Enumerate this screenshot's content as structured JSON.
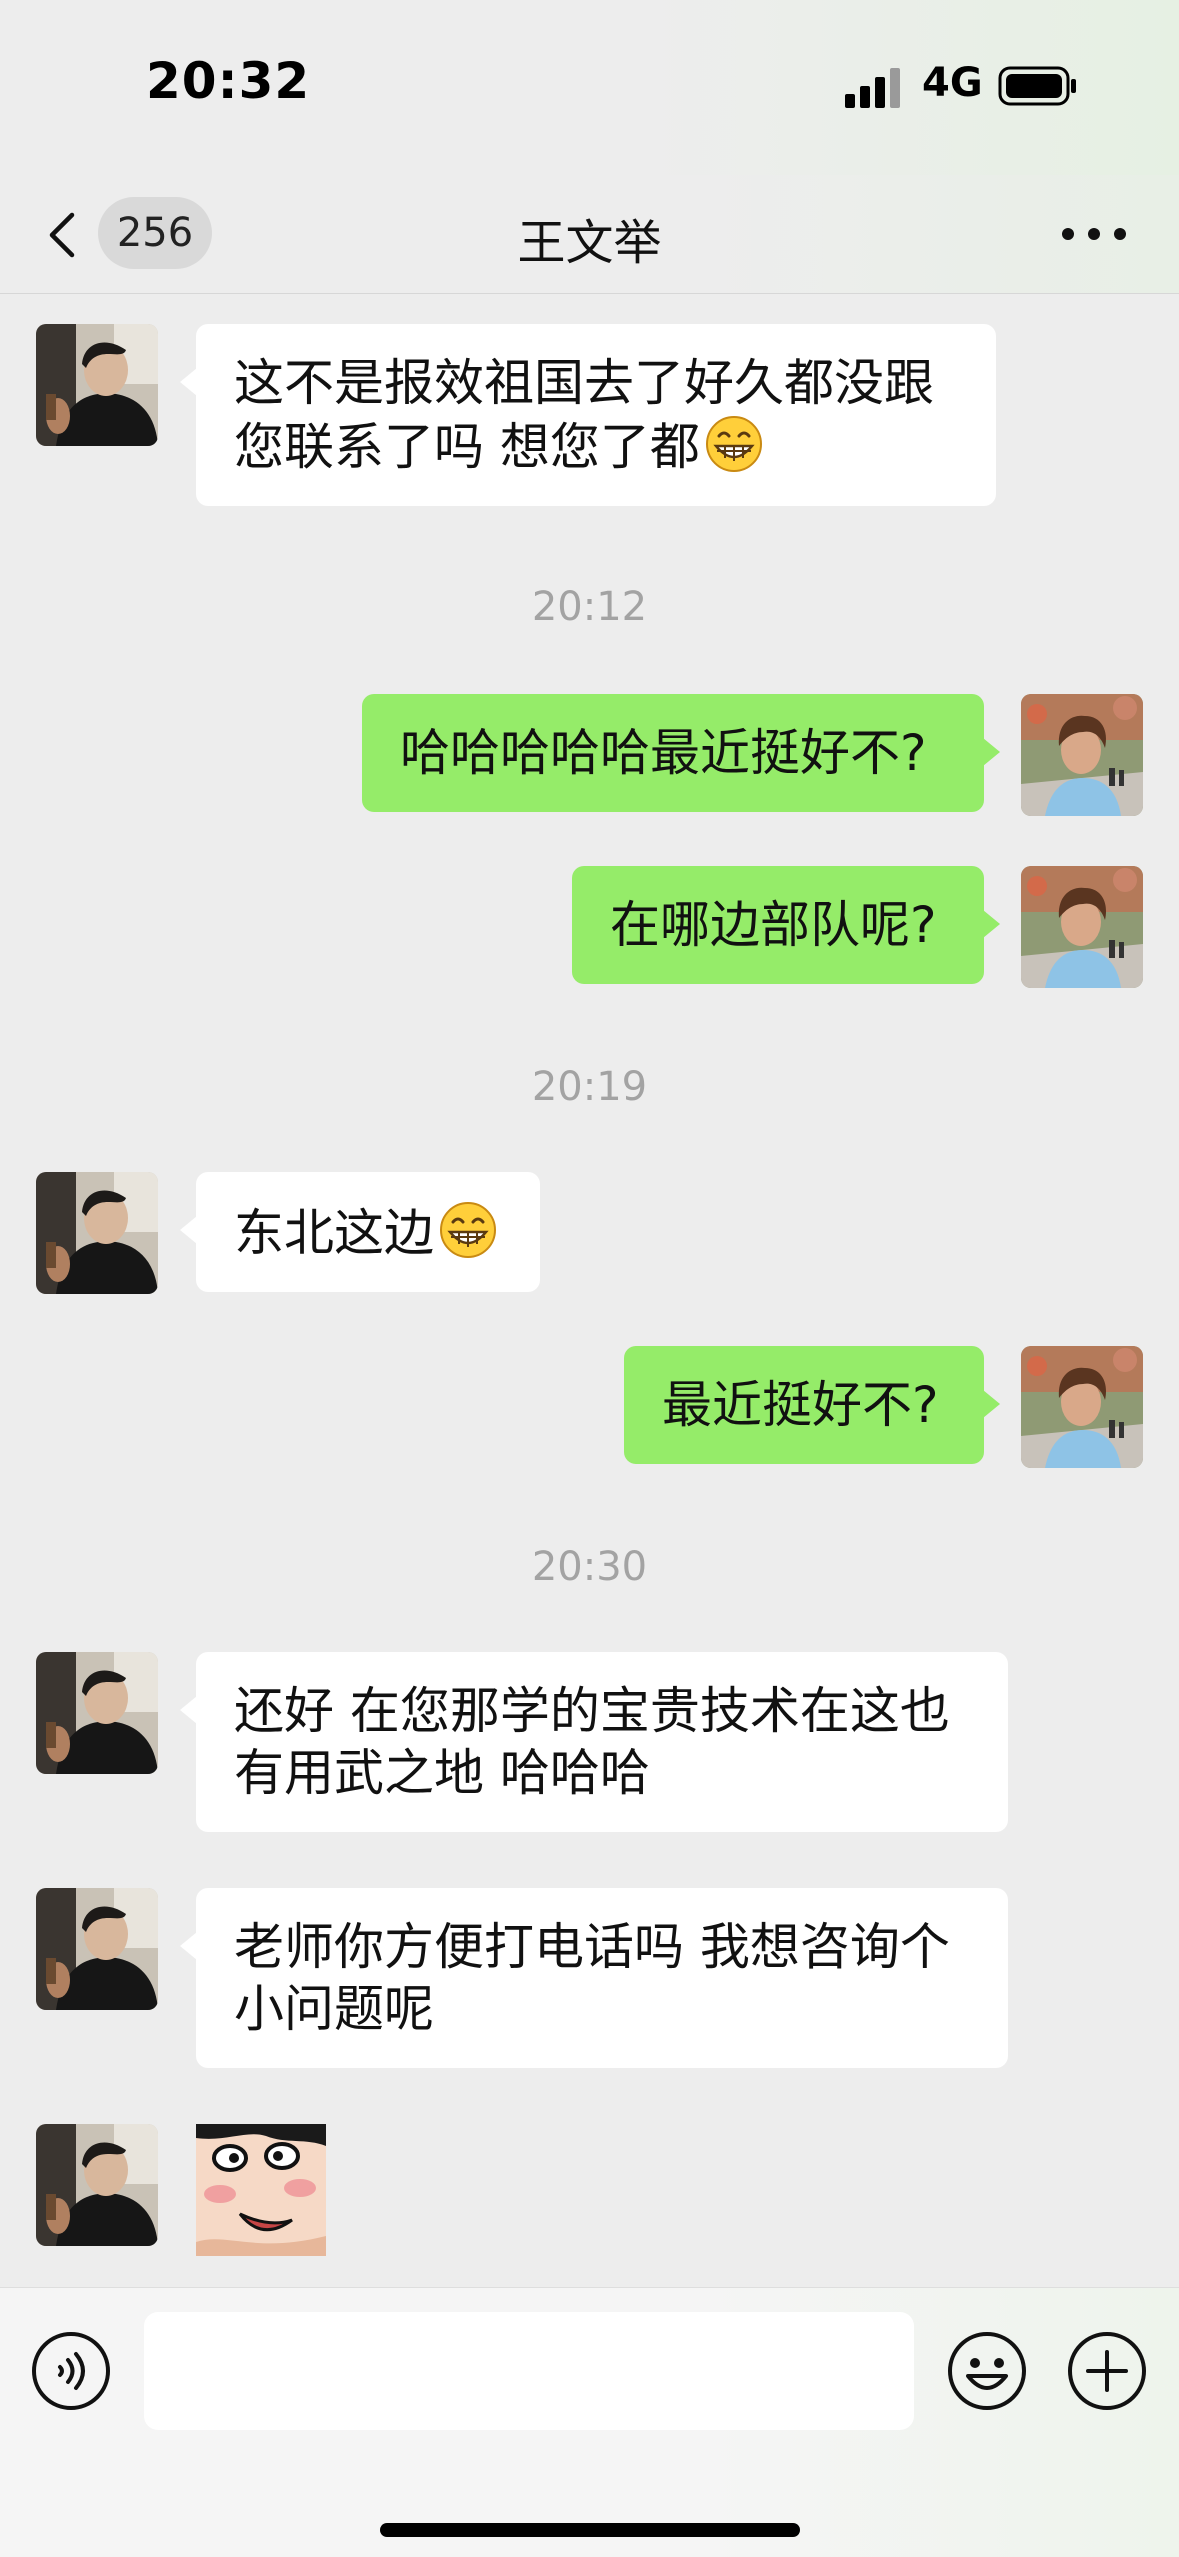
{
  "status_bar": {
    "time": "20:32",
    "network": "4G",
    "icons": [
      "signal-icon",
      "battery-icon"
    ]
  },
  "header": {
    "back_icon": "chevron-left-icon",
    "unread_count": "256",
    "title": "王文举",
    "more_icon": "more-dots-icon"
  },
  "messages": [
    {
      "side": "left",
      "lines": [
        "这不是报效祖国去了好久都没跟",
        "您联系了吗 想您了都"
      ],
      "emoji": "grinning-face-icon"
    },
    {
      "timestamp": "20:12"
    },
    {
      "side": "right",
      "lines": [
        "哈哈哈哈哈最近挺好不?"
      ]
    },
    {
      "side": "right",
      "lines": [
        "在哪边部队呢?"
      ]
    },
    {
      "timestamp": "20:19"
    },
    {
      "side": "left",
      "lines": [
        "东北这边"
      ],
      "emoji": "grinning-face-icon"
    },
    {
      "side": "right",
      "lines": [
        "最近挺好不?"
      ]
    },
    {
      "timestamp": "20:30"
    },
    {
      "side": "left",
      "lines": [
        "还好 在您那学的宝贵技术在这也",
        "有用武之地 哈哈哈"
      ]
    },
    {
      "side": "left",
      "lines": [
        "老师你方便打电话吗 我想咨询个",
        "小问题呢"
      ]
    },
    {
      "side": "left",
      "sticker": "cartoon-sticker"
    }
  ],
  "input_bar": {
    "voice_icon": "voice-icon",
    "input_value": "",
    "emoji_icon": "emoji-icon",
    "plus_icon": "plus-icon"
  },
  "colors": {
    "background": "#ededed",
    "sent_bubble": "#95ec69",
    "received_bubble": "#ffffff",
    "timestamp_text": "#a3a3a3"
  }
}
